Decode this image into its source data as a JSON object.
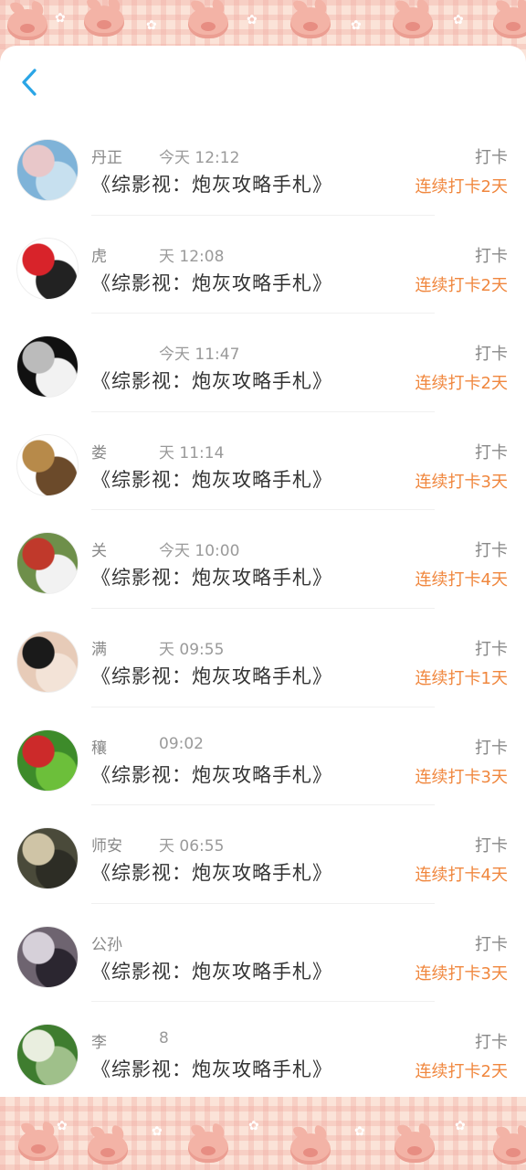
{
  "header": {
    "back_icon": "chevron-left-icon",
    "accent": "#2aa5e6"
  },
  "colors": {
    "streak": "#f0873e",
    "title": "#333333",
    "meta": "#888888"
  },
  "items": [
    {
      "name": "丹正",
      "time": "今天 12:12",
      "title": "《综影视：炮灰攻略手札》",
      "action": "打卡",
      "streak": "连续打卡2天",
      "avatar_colors": [
        "#7fb3d8",
        "#e8c7c9",
        "#c7e0ef"
      ]
    },
    {
      "name": "虎",
      "time": "天 12:08",
      "title": "《综影视：炮灰攻略手札》",
      "action": "打卡",
      "streak": "连续打卡2天",
      "avatar_colors": [
        "#ffffff",
        "#d8232a",
        "#222222"
      ]
    },
    {
      "name": "",
      "time": "今天 11:47",
      "title": "《综影视：炮灰攻略手札》",
      "action": "打卡",
      "streak": "连续打卡2天",
      "avatar_colors": [
        "#111111",
        "#bbbbbb",
        "#f2f2f2"
      ]
    },
    {
      "name": "娄",
      "time": "天 11:14",
      "title": "《综影视：炮灰攻略手札》",
      "action": "打卡",
      "streak": "连续打卡3天",
      "avatar_colors": [
        "#ffffff",
        "#b78a4a",
        "#6b4a2a"
      ]
    },
    {
      "name": "关",
      "time": "今天 10:00",
      "title": "《综影视：炮灰攻略手札》",
      "action": "打卡",
      "streak": "连续打卡4天",
      "avatar_colors": [
        "#6e8f4a",
        "#c0392b",
        "#f2f2f2"
      ]
    },
    {
      "name": "满",
      "time": "天 09:55",
      "title": "《综影视：炮灰攻略手札》",
      "action": "打卡",
      "streak": "连续打卡1天",
      "avatar_colors": [
        "#e7cbb8",
        "#1a1a1a",
        "#f3e3d7"
      ]
    },
    {
      "name": "穰",
      "time": "09:02",
      "title": "《综影视：炮灰攻略手札》",
      "action": "打卡",
      "streak": "连续打卡3天",
      "avatar_colors": [
        "#3d8b2a",
        "#cc2a2a",
        "#6cbf3a"
      ]
    },
    {
      "name": "师安",
      "time": "天 06:55",
      "title": "《综影视：炮灰攻略手札》",
      "action": "打卡",
      "streak": "连续打卡4天",
      "avatar_colors": [
        "#4a4a3a",
        "#cfc4a6",
        "#2d2d25"
      ]
    },
    {
      "name": "公孙",
      "time": "",
      "title": "《综影视：炮灰攻略手札》",
      "action": "打卡",
      "streak": "连续打卡3天",
      "avatar_colors": [
        "#6e6470",
        "#d6d0d9",
        "#2b2630"
      ]
    },
    {
      "name": "李",
      "time": "8",
      "title": "《综影视：炮灰攻略手札》",
      "action": "打卡",
      "streak": "连续打卡2天",
      "avatar_colors": [
        "#3f7d2f",
        "#e9eedf",
        "#9fc08a"
      ]
    }
  ]
}
